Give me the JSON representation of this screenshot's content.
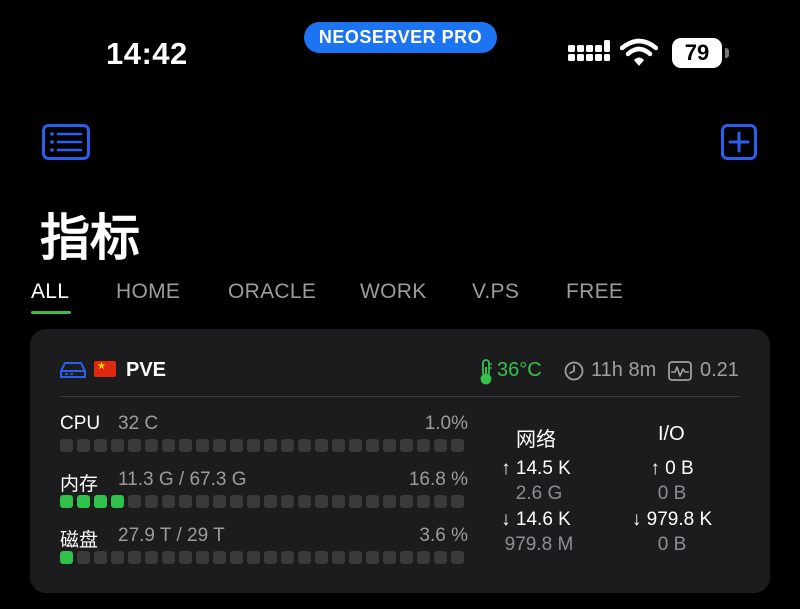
{
  "status_bar": {
    "time": "14:42",
    "app_pill": "NEOSERVER PRO",
    "battery": "79"
  },
  "page": {
    "title": "指标"
  },
  "tabs": [
    {
      "label": "ALL",
      "active": true
    },
    {
      "label": "HOME",
      "active": false
    },
    {
      "label": "ORACLE",
      "active": false
    },
    {
      "label": "WORK",
      "active": false
    },
    {
      "label": "V.PS",
      "active": false
    },
    {
      "label": "FREE",
      "active": false
    }
  ],
  "server": {
    "name": "PVE",
    "temperature": "36°C",
    "uptime": "11h 8m",
    "load": "0.21",
    "metrics": {
      "cpu": {
        "label": "CPU",
        "detail": "32 C",
        "percent": "1.0%",
        "fill_fraction": 0.01
      },
      "memory": {
        "label": "内存",
        "detail": "11.3 G / 67.3 G",
        "percent": "16.8 %",
        "fill_fraction": 0.168
      },
      "disk": {
        "label": "磁盘",
        "detail": "27.9 T / 29 T",
        "percent": "3.6 %",
        "fill_fraction": 0.036
      }
    },
    "network": {
      "header": "网络",
      "up_rate": "↑ 14.5 K",
      "up_total": "2.6 G",
      "down_rate": "↓ 14.6 K",
      "down_total": "979.8 M"
    },
    "io": {
      "header": "I/O",
      "read_rate": "↑ 0 B",
      "read_total": "0 B",
      "write_rate": "↓ 979.8 K",
      "write_total": "0 B"
    }
  },
  "colors": {
    "accent_blue": "#1c74f2",
    "icon_blue": "#2a5ff0",
    "good_green": "#30c24a",
    "card_bg": "#1c1c1e"
  }
}
